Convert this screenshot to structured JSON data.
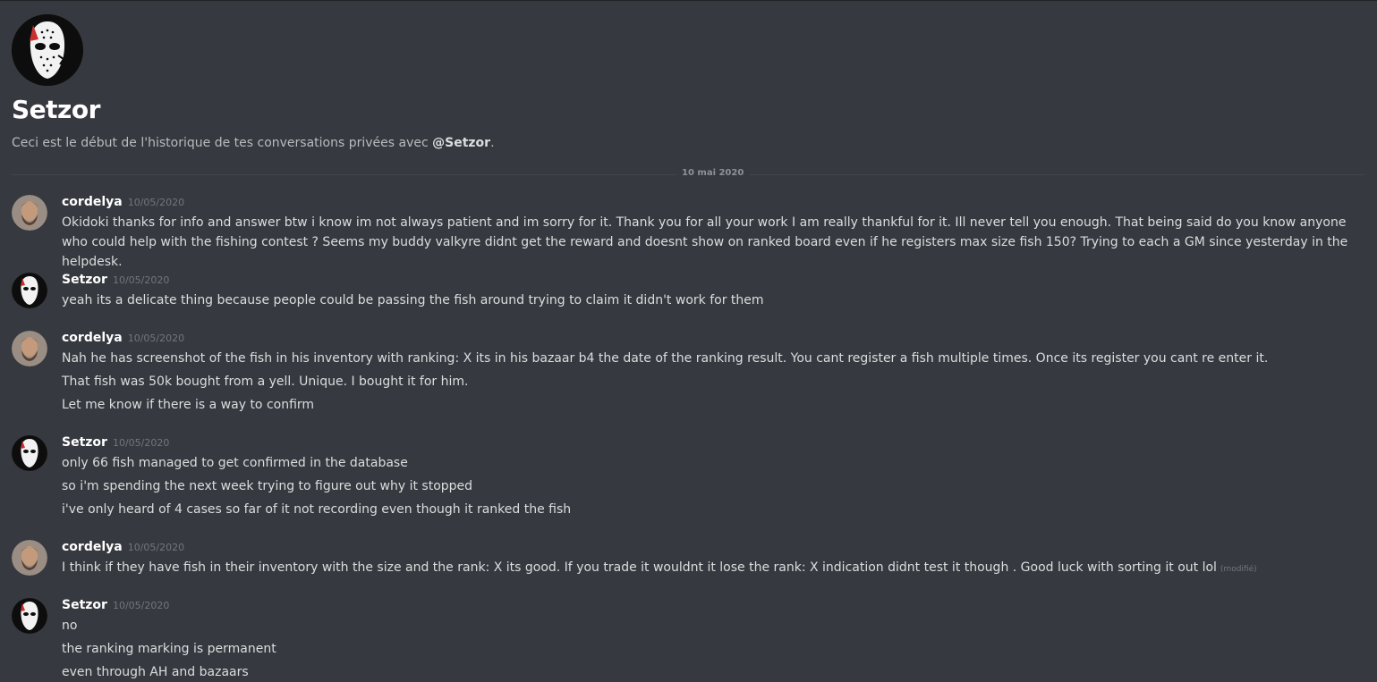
{
  "dm": {
    "title": "Setzor",
    "intro_prefix": "Ceci est le début de l'historique de tes conversations privées avec ",
    "intro_user": "@Setzor",
    "intro_suffix": "."
  },
  "date_divider": "10 mai 2020",
  "messages": [
    {
      "author": "cordelya",
      "time": "10/05/2020",
      "lines": [
        "Okidoki thanks for info and answer btw i know im not always patient and im sorry for it. Thank you for all your work I am really thankful for it. Ill never tell you enough. That being said do you know anyone who could help with the fishing contest  ? Seems my buddy valkyre didnt get the reward and doesnt show on ranked board even if he registers max size fish 150? Trying to each a GM since yesterday in the helpdesk."
      ]
    },
    {
      "author": "Setzor",
      "time": "10/05/2020",
      "lines": [
        "yeah its a delicate thing because people could be passing the fish around trying to claim it didn't work for them"
      ]
    },
    {
      "author": "cordelya",
      "time": "10/05/2020",
      "lines": [
        "Nah he has screenshot of the fish in his inventory with ranking: X its in his bazaar  b4 the date of the ranking result. You cant register a fish multiple times. Once its register you cant re enter it.",
        "That fish was 50k bought from a yell. Unique. I bought it for him.",
        "Let me know if there is a way to confirm"
      ]
    },
    {
      "author": "Setzor",
      "time": "10/05/2020",
      "lines": [
        "only 66 fish managed to get confirmed in the database",
        "so i'm spending the next week trying to figure out why it stopped",
        "i've only heard of 4 cases so far of it not recording even though it ranked the fish"
      ]
    },
    {
      "author": "cordelya",
      "time": "10/05/2020",
      "lines": [
        "I think if they have fish in their inventory with the size and the rank: X its good. If you trade it  wouldnt it lose the rank: X indication didnt test it though . Good luck with sorting it out lol"
      ],
      "edited": "(modifié)"
    },
    {
      "author": "Setzor",
      "time": "10/05/2020",
      "lines": [
        "no",
        "the ranking marking is permanent",
        "even through AH and bazaars"
      ]
    }
  ],
  "colors": {
    "background": "#36393f",
    "text": "#dcddde",
    "muted": "#72767d"
  }
}
